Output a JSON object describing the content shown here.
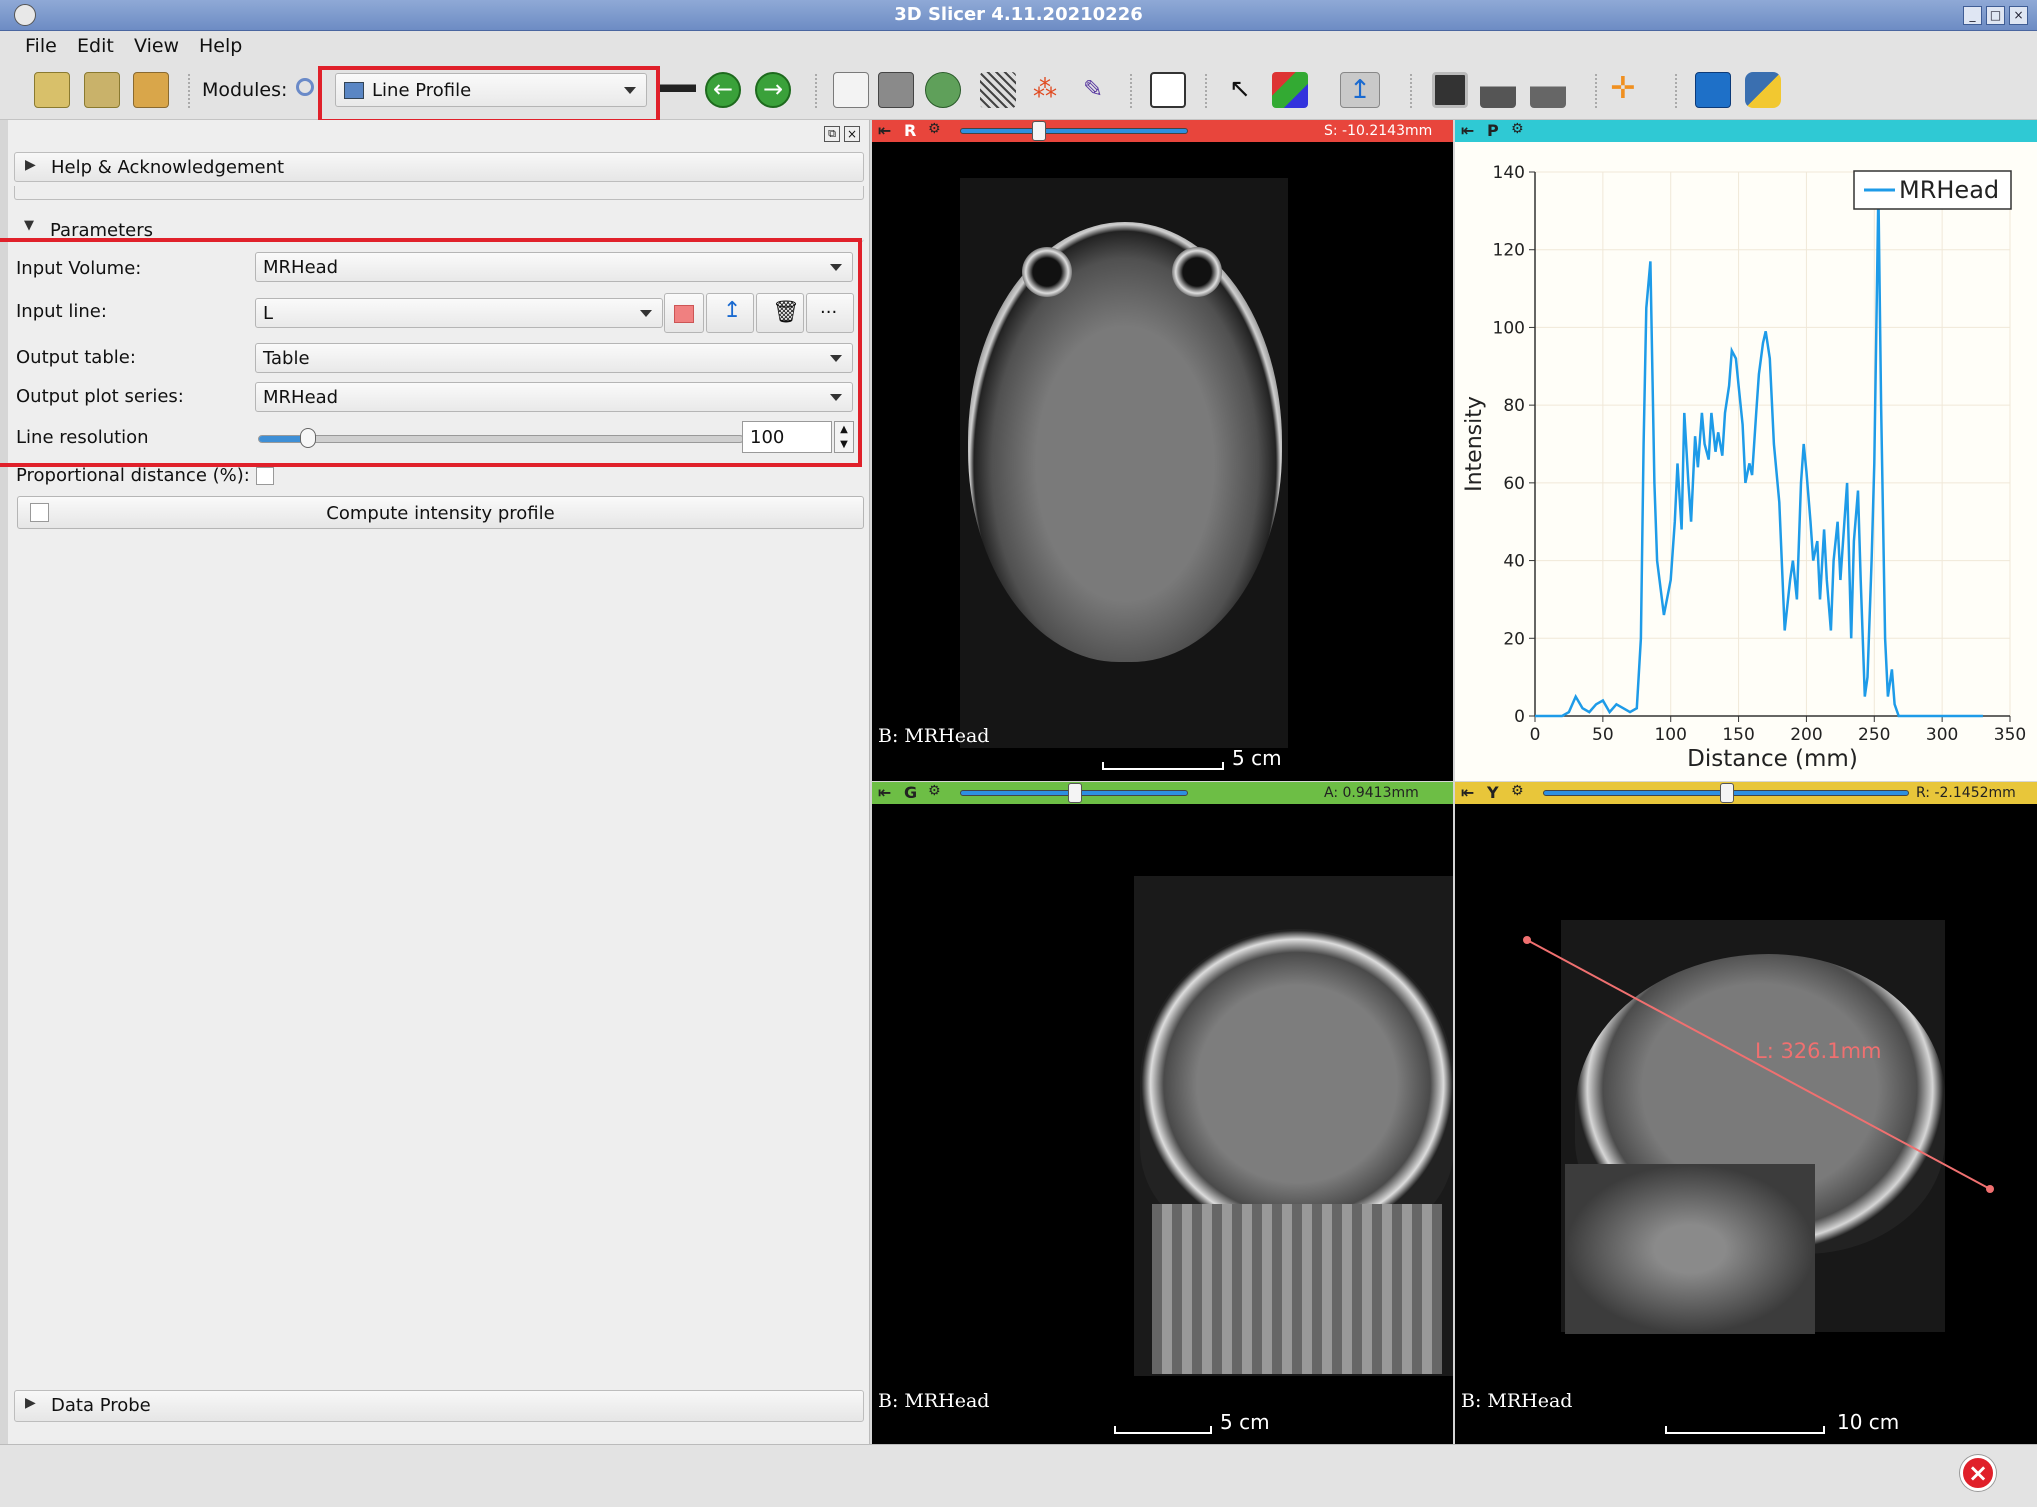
{
  "window": {
    "title": "3D Slicer 4.11.20210226"
  },
  "menu": [
    "File",
    "Edit",
    "View",
    "Help"
  ],
  "toolbar": {
    "modules_label": "Modules:",
    "module_selected": "Line Profile"
  },
  "panel": {
    "help_section": "Help & Acknowledgement",
    "parameters_section": "Parameters",
    "input_volume_label": "Input Volume:",
    "input_volume": "MRHead",
    "input_line_label": "Input line:",
    "input_line": "L",
    "output_table_label": "Output table:",
    "output_table": "Table",
    "output_plot_label": "Output plot series:",
    "output_plot": "MRHead",
    "line_resolution_label": "Line resolution",
    "line_resolution": "100",
    "line_resolution_fraction": 0.1,
    "proportional_label": "Proportional distance (%):",
    "compute_button": "Compute intensity profile",
    "data_probe_section": "Data Probe"
  },
  "views": {
    "red": {
      "letter": "R",
      "coord": "S: -10.2143mm",
      "color": "#e8453c",
      "slider": 0.34,
      "label": "B: MRHead",
      "scale": "5 cm"
    },
    "plot": {
      "letter": "P",
      "color": "#2fc9d4"
    },
    "green": {
      "letter": "G",
      "coord": "A: 0.9413mm",
      "color": "#6dbe45",
      "slider": 0.5,
      "label": "B: MRHead",
      "scale": "5 cm"
    },
    "yellow": {
      "letter": "Y",
      "coord": "R: -2.1452mm",
      "color": "#e8c63a",
      "slider": 0.5,
      "label": "B: MRHead",
      "scale": "10 cm"
    },
    "line_measure": "L: 326.1mm"
  },
  "chart_data": {
    "type": "line",
    "xlabel": "Distance (mm)",
    "ylabel": "Intensity",
    "xlim": [
      0,
      350
    ],
    "ylim": [
      0,
      140
    ],
    "xticks": [
      "0",
      "50",
      "100",
      "150",
      "200",
      "250",
      "300",
      "350"
    ],
    "yticks": [
      "0",
      "20",
      "40",
      "60",
      "80",
      "100",
      "120",
      "140"
    ],
    "legend_position": "top-right",
    "line_color": "#1e9be8",
    "series": [
      {
        "name": "MRHead",
        "x": [
          0,
          20,
          25,
          30,
          35,
          40,
          45,
          50,
          55,
          60,
          65,
          70,
          75,
          78,
          80,
          82,
          85,
          88,
          90,
          95,
          100,
          103,
          105,
          108,
          110,
          113,
          115,
          118,
          120,
          123,
          125,
          128,
          130,
          133,
          135,
          138,
          140,
          143,
          145,
          148,
          150,
          153,
          155,
          158,
          160,
          163,
          165,
          168,
          170,
          173,
          176,
          180,
          184,
          188,
          190,
          193,
          196,
          198,
          200,
          203,
          205,
          208,
          210,
          213,
          215,
          218,
          220,
          223,
          225,
          228,
          230,
          233,
          235,
          238,
          240,
          243,
          245,
          248,
          250,
          253,
          255,
          258,
          260,
          263,
          265,
          268,
          270,
          273,
          276,
          278,
          280,
          283,
          286,
          290,
          300,
          330
        ],
        "y": [
          0,
          0,
          1,
          5,
          2,
          1,
          3,
          4,
          1,
          3,
          2,
          1,
          2,
          20,
          70,
          105,
          117,
          60,
          40,
          26,
          35,
          50,
          65,
          48,
          78,
          60,
          50,
          72,
          64,
          78,
          70,
          66,
          78,
          68,
          73,
          67,
          78,
          85,
          94,
          92,
          85,
          75,
          60,
          65,
          62,
          78,
          88,
          96,
          99,
          92,
          70,
          55,
          22,
          35,
          40,
          30,
          60,
          70,
          63,
          50,
          40,
          45,
          30,
          48,
          35,
          22,
          40,
          50,
          35,
          50,
          60,
          20,
          45,
          58,
          35,
          5,
          10,
          40,
          65,
          135,
          80,
          20,
          5,
          12,
          3,
          0,
          0,
          0,
          0,
          0,
          0,
          0,
          0,
          0,
          0,
          0
        ]
      }
    ]
  }
}
